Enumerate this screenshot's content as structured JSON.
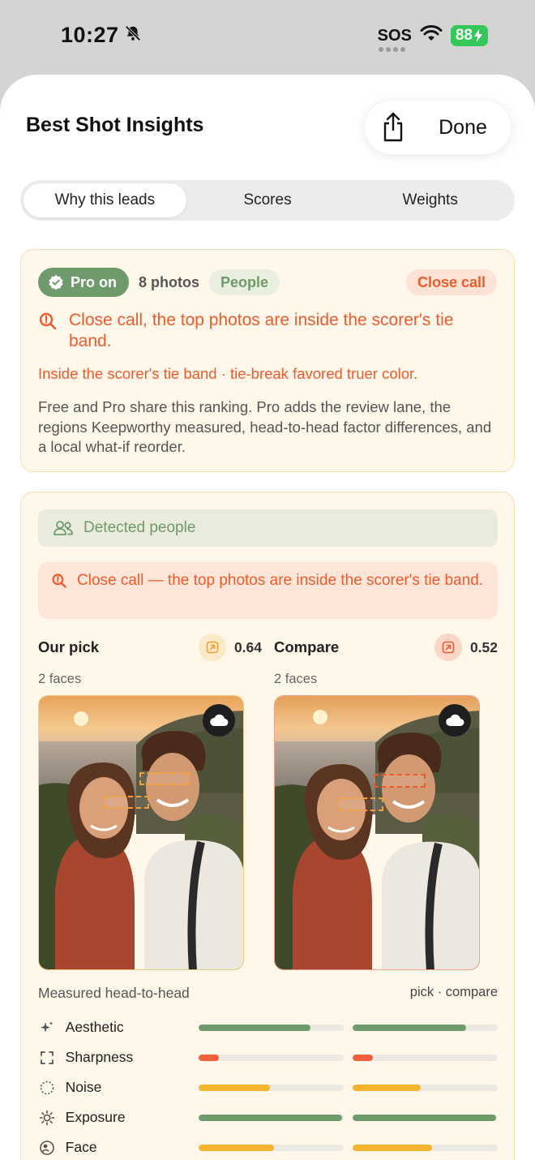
{
  "status_bar": {
    "time": "10:27",
    "carrier": "SOS",
    "battery": "88"
  },
  "sheet": {
    "title": "Best Shot Insights",
    "share_icon": "share-icon",
    "done_label": "Done"
  },
  "tabs": [
    {
      "label": "Why this leads",
      "active": true
    },
    {
      "label": "Scores",
      "active": false
    },
    {
      "label": "Weights",
      "active": false
    }
  ],
  "summary": {
    "pro_chip": "Pro on",
    "photo_count": "8 photos",
    "category_chip": "People",
    "status_chip": "Close call",
    "headline": "Close call, the top photos are inside the scorer's tie band.",
    "subline": "Inside the scorer's tie band · tie-break favored truer color.",
    "body": "Free and Pro share this ranking. Pro adds the review lane, the regions Keepworthy measured, head-to-head factor differences, and a local what-if reorder."
  },
  "detail": {
    "detected_label": "Detected people",
    "warning": "Close call — the top photos are inside the scorer's tie band.",
    "pick": {
      "title": "Our pick",
      "score": "0.64",
      "faces": "2 faces"
    },
    "compare": {
      "title": "Compare",
      "score": "0.52",
      "faces": "2 faces"
    },
    "measured_title": "Measured head-to-head",
    "measured_legend": "pick · compare",
    "factors": [
      {
        "label": "Aesthetic",
        "icon": "sparkle-icon",
        "pick": 0.77,
        "compare": 0.78,
        "color": "#6f9a6c"
      },
      {
        "label": "Sharpness",
        "icon": "focus-frame-icon",
        "pick": 0.14,
        "compare": 0.14,
        "color": "#f25f3a"
      },
      {
        "label": "Noise",
        "icon": "dotted-circle-icon",
        "pick": 0.49,
        "compare": 0.47,
        "color": "#f5b52f"
      },
      {
        "label": "Exposure",
        "icon": "sun-icon",
        "pick": 0.99,
        "compare": 0.99,
        "color": "#6f9a6c"
      },
      {
        "label": "Face",
        "icon": "face-icon",
        "pick": 0.52,
        "compare": 0.55,
        "color": "#f5b52f"
      }
    ]
  },
  "colors": {
    "accent_green": "#6f9a6c",
    "alert_orange": "#ef5a2d",
    "card_bg": "#fff7ea"
  }
}
